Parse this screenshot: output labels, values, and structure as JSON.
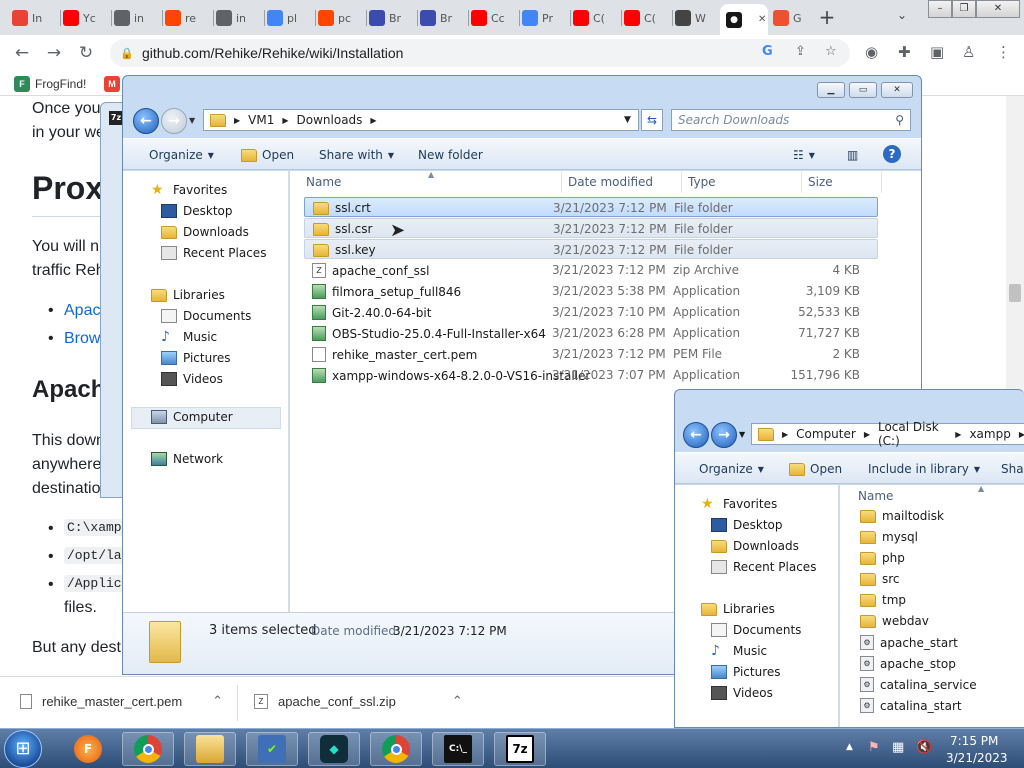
{
  "browser": {
    "tabs": [
      {
        "icon": "gmail-icon",
        "label": "In",
        "color": "#ea4335"
      },
      {
        "icon": "youtube-icon",
        "label": "Yc",
        "color": "#ff0000"
      },
      {
        "icon": "globe-icon",
        "label": "in",
        "color": "#5f6368"
      },
      {
        "icon": "reddit-icon",
        "label": "re",
        "color": "#ff4500"
      },
      {
        "icon": "globe-icon",
        "label": "in",
        "color": "#5f6368"
      },
      {
        "icon": "google-icon",
        "label": "pl",
        "color": "#4285f4"
      },
      {
        "icon": "reddit-icon",
        "label": "pc",
        "color": "#ff4500"
      },
      {
        "icon": "brave-icon",
        "label": "Br",
        "color": "#3b4cae"
      },
      {
        "icon": "brave-icon",
        "label": "Br",
        "color": "#3b4cae"
      },
      {
        "icon": "youtube-icon",
        "label": "Cc",
        "color": "#ff0000"
      },
      {
        "icon": "google-icon",
        "label": "Pr",
        "color": "#4285f4"
      },
      {
        "icon": "youtube-icon",
        "label": "C(",
        "color": "#ff0000"
      },
      {
        "icon": "youtube-icon",
        "label": "C(",
        "color": "#ff0000"
      },
      {
        "icon": "museum-icon",
        "label": "W",
        "color": "#444444"
      },
      {
        "icon": "github-icon",
        "label": "",
        "color": "#181717",
        "active": true
      },
      {
        "icon": "git-icon",
        "label": "G",
        "color": "#f05032"
      }
    ],
    "new_tab": "+",
    "tab_menu": "⌄",
    "url": "github.com/Rehike/Rehike/wiki/Installation",
    "bookmarks": [
      {
        "icon": "frogfind-icon",
        "label": "FrogFind!"
      },
      {
        "icon": "gmail-icon",
        "label": ""
      }
    ]
  },
  "page": {
    "lines": [
      "Once you",
      "in your we",
      "Proxy",
      "You will n",
      "traffic Reh",
      "Apac",
      "Brow",
      "Apache",
      "This down",
      "anywhere",
      "destinatio",
      "files.",
      "But any desti"
    ],
    "code_items": [
      "C:\\xamp",
      "/opt/la",
      "/Applic"
    ]
  },
  "downloads_shelf": [
    {
      "icon": "file-icon",
      "label": "rehike_master_cert.pem"
    },
    {
      "icon": "zip-icon",
      "label": "apache_conf_ssl.zip"
    }
  ],
  "explorer_main": {
    "breadcrumb": [
      "VM1",
      "Downloads"
    ],
    "search_placeholder": "Search Downloads",
    "commands": [
      "Organize",
      "Open",
      "Share with",
      "New folder"
    ],
    "nav": {
      "favorites_label": "Favorites",
      "favorites": [
        "Desktop",
        "Downloads",
        "Recent Places"
      ],
      "libraries_label": "Libraries",
      "libraries": [
        "Documents",
        "Music",
        "Pictures",
        "Videos"
      ],
      "computer": "Computer",
      "network": "Network"
    },
    "columns": [
      "Name",
      "Date modified",
      "Type",
      "Size"
    ],
    "files": [
      {
        "name": "ssl.crt",
        "date": "3/21/2023 7:12 PM",
        "type": "File folder",
        "size": "",
        "kind": "folder",
        "state": "sel"
      },
      {
        "name": "ssl.csr",
        "date": "3/21/2023 7:12 PM",
        "type": "File folder",
        "size": "",
        "kind": "folder",
        "state": "sel2"
      },
      {
        "name": "ssl.key",
        "date": "3/21/2023 7:12 PM",
        "type": "File folder",
        "size": "",
        "kind": "folder",
        "state": "sel2"
      },
      {
        "name": "apache_conf_ssl",
        "date": "3/21/2023 7:12 PM",
        "type": "zip Archive",
        "size": "4 KB",
        "kind": "zip",
        "state": ""
      },
      {
        "name": "filmora_setup_full846",
        "date": "3/21/2023 5:38 PM",
        "type": "Application",
        "size": "3,109 KB",
        "kind": "app",
        "state": ""
      },
      {
        "name": "Git-2.40.0-64-bit",
        "date": "3/21/2023 7:10 PM",
        "type": "Application",
        "size": "52,533 KB",
        "kind": "app",
        "state": ""
      },
      {
        "name": "OBS-Studio-25.0.4-Full-Installer-x64",
        "date": "3/21/2023 6:28 PM",
        "type": "Application",
        "size": "71,727 KB",
        "kind": "app",
        "state": ""
      },
      {
        "name": "rehike_master_cert.pem",
        "date": "3/21/2023 7:12 PM",
        "type": "PEM File",
        "size": "2 KB",
        "kind": "doc",
        "state": ""
      },
      {
        "name": "xampp-windows-x64-8.2.0-0-VS16-installer",
        "date": "3/21/2023 7:07 PM",
        "type": "Application",
        "size": "151,796 KB",
        "kind": "app",
        "state": ""
      }
    ],
    "status_count": "3 items selected",
    "status_date_label": "Date modified:",
    "status_date": "3/21/2023 7:12 PM"
  },
  "explorer_second": {
    "breadcrumb": [
      "Computer",
      "Local Disk (C:)",
      "xampp"
    ],
    "commands": [
      "Organize",
      "Open",
      "Include in library",
      "Shar"
    ],
    "nav": {
      "favorites_label": "Favorites",
      "favorites": [
        "Desktop",
        "Downloads",
        "Recent Places"
      ],
      "libraries_label": "Libraries",
      "libraries": [
        "Documents",
        "Music",
        "Pictures",
        "Videos"
      ]
    },
    "column_name": "Name",
    "files": [
      {
        "name": "mailtodisk",
        "kind": "folder"
      },
      {
        "name": "mysql",
        "kind": "folder"
      },
      {
        "name": "php",
        "kind": "folder"
      },
      {
        "name": "src",
        "kind": "folder"
      },
      {
        "name": "tmp",
        "kind": "folder"
      },
      {
        "name": "webdav",
        "kind": "folder"
      },
      {
        "name": "apache_start",
        "kind": "bat"
      },
      {
        "name": "apache_stop",
        "kind": "bat"
      },
      {
        "name": "catalina_service",
        "kind": "bat"
      },
      {
        "name": "catalina_start",
        "kind": "bat"
      }
    ]
  },
  "taskbar": {
    "apps": [
      "firefox-icon",
      "chrome-icon",
      "explorer-icon",
      "checklist-icon",
      "filmora-icon",
      "chrome-icon",
      "cmd-icon",
      "7zip-icon"
    ],
    "time": "7:15 PM",
    "date": "3/21/2023"
  }
}
